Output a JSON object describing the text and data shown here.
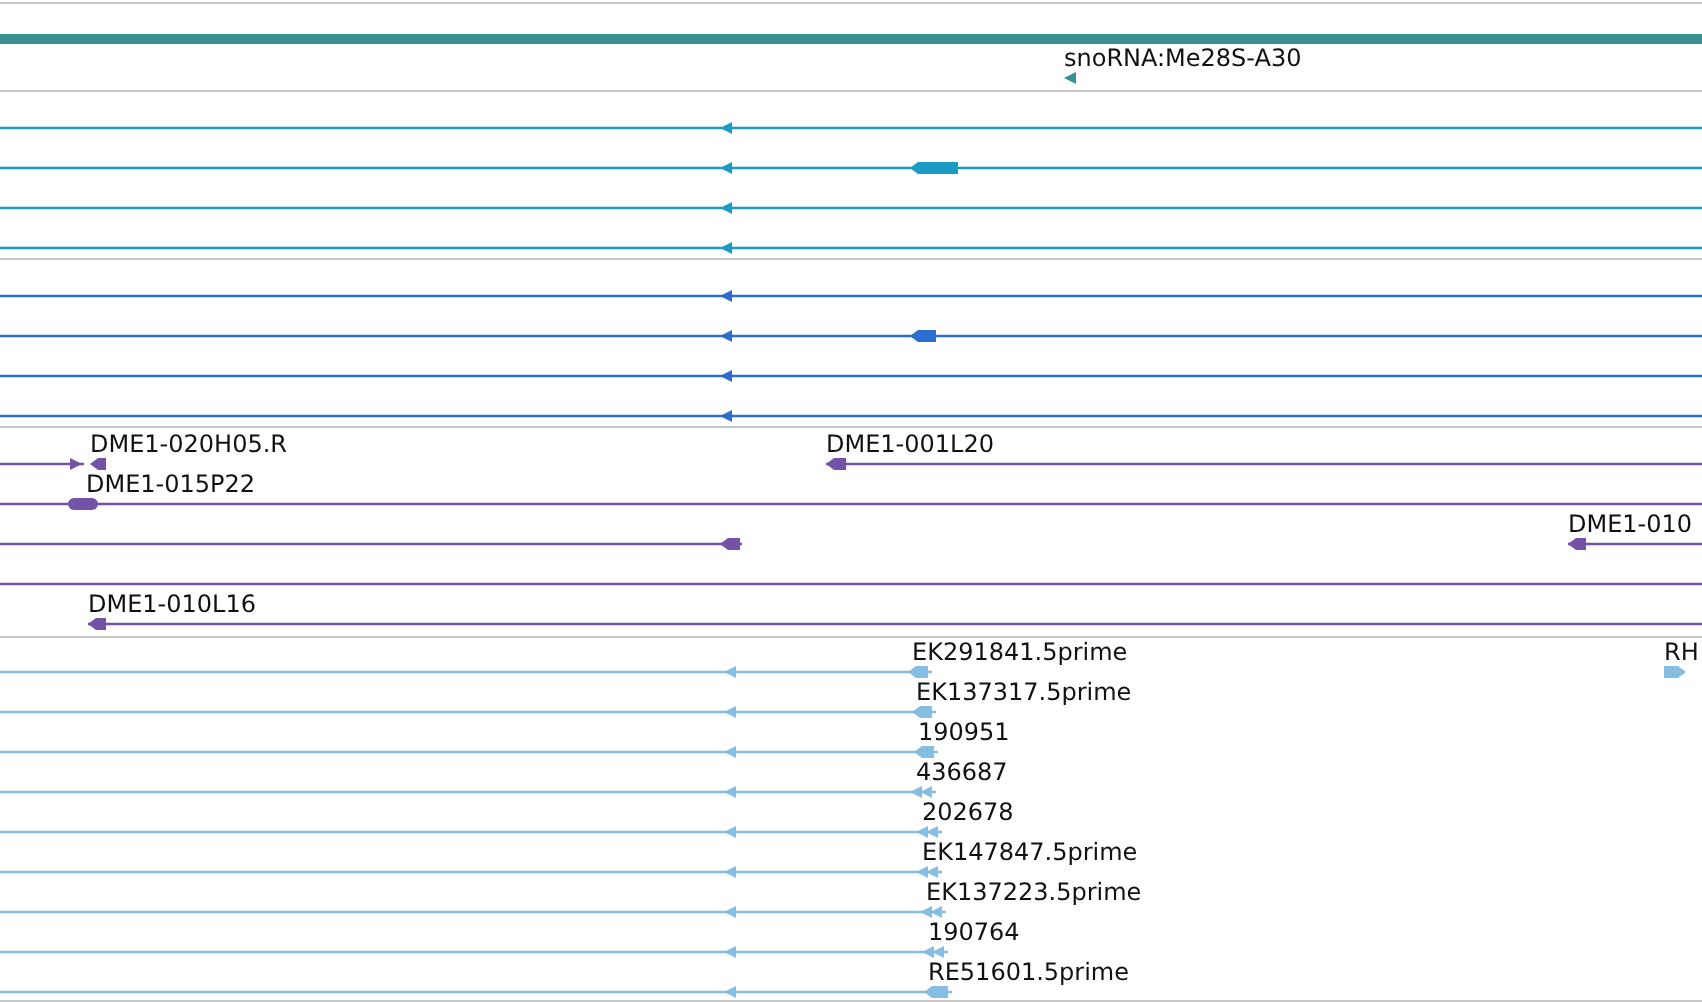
{
  "tracks": [
    {
      "color": "#3a8f94",
      "labels": [
        "snoRNA:Me28S-A30"
      ]
    },
    {
      "color": "#1a9bc3"
    },
    {
      "color": "#2b6dd0"
    },
    {
      "color": "#7352a8",
      "labels": [
        "DME1-020H05.R",
        "DME1-001L20",
        "DME1-015P22",
        "DME1-010",
        "DME1-010L16"
      ]
    },
    {
      "color": "#86bde2",
      "labels": [
        "EK291841.5prime",
        "RH",
        "EK137317.5prime",
        "190951",
        "436687",
        "202678",
        "EK147847.5prime",
        "EK137223.5prime",
        "190764",
        "RE51601.5prime"
      ]
    }
  ]
}
